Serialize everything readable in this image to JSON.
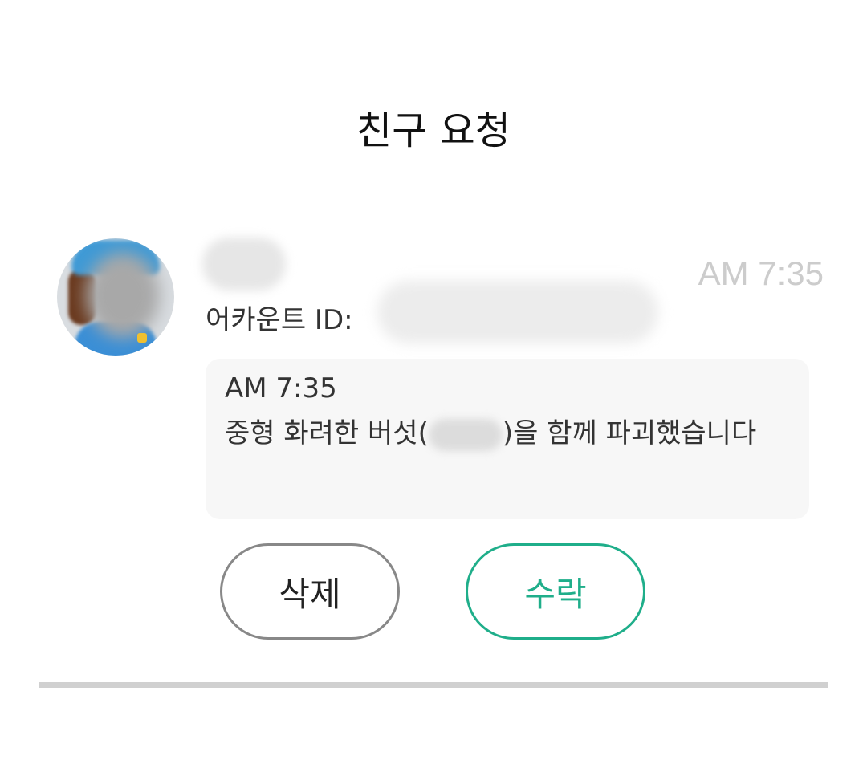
{
  "header": {
    "title": "친구 요청"
  },
  "request": {
    "time": "AM 7:35",
    "account_label": "어카운트 ID:",
    "message": {
      "time": "AM 7:35",
      "text_before": "중형 화려한 버섯(",
      "text_after": ")을 함께 파괴했습니다"
    },
    "buttons": {
      "delete_label": "삭제",
      "accept_label": "수락"
    }
  },
  "colors": {
    "accent": "#1fae8a",
    "delete_border": "#888888",
    "time_text": "#cccccc",
    "card_bg": "#f7f7f7",
    "divider": "#d0d0d0"
  }
}
